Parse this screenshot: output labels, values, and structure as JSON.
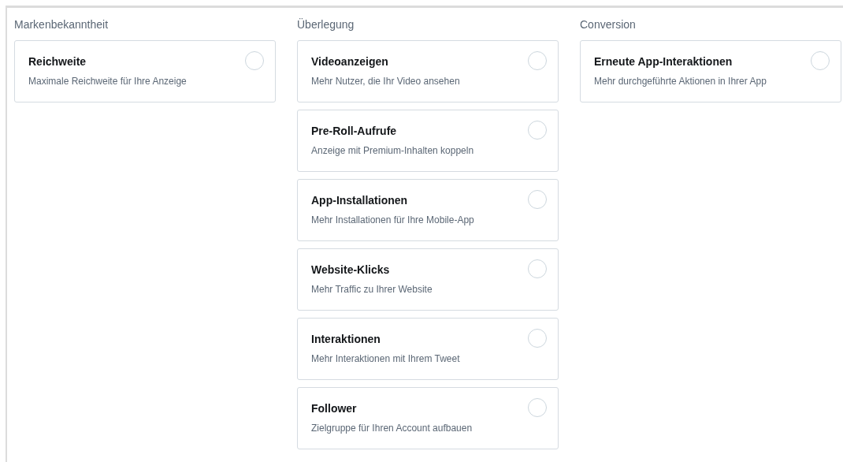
{
  "columns": [
    {
      "title": "Markenbekanntheit",
      "options": [
        {
          "title": "Reichweite",
          "description": "Maximale Reichweite für Ihre Anzeige",
          "selected": false
        }
      ]
    },
    {
      "title": "Überlegung",
      "options": [
        {
          "title": "Videoanzeigen",
          "description": "Mehr Nutzer, die Ihr Video ansehen",
          "selected": false
        },
        {
          "title": "Pre-Roll-Aufrufe",
          "description": "Anzeige mit Premium-Inhalten koppeln",
          "selected": false
        },
        {
          "title": "App-Installationen",
          "description": "Mehr Installationen für Ihre Mobile-App",
          "selected": false
        },
        {
          "title": "Website-Klicks",
          "description": "Mehr Traffic zu Ihrer Website",
          "selected": false
        },
        {
          "title": "Interaktionen",
          "description": "Mehr Interaktionen mit Ihrem Tweet",
          "selected": false
        },
        {
          "title": "Follower",
          "description": "Zielgruppe für Ihren Account aufbauen",
          "selected": false
        }
      ]
    },
    {
      "title": "Conversion",
      "options": [
        {
          "title": "Erneute App-Interaktionen",
          "description": "Mehr durchgeführte Aktionen in Ihrer App",
          "selected": false
        }
      ]
    }
  ]
}
